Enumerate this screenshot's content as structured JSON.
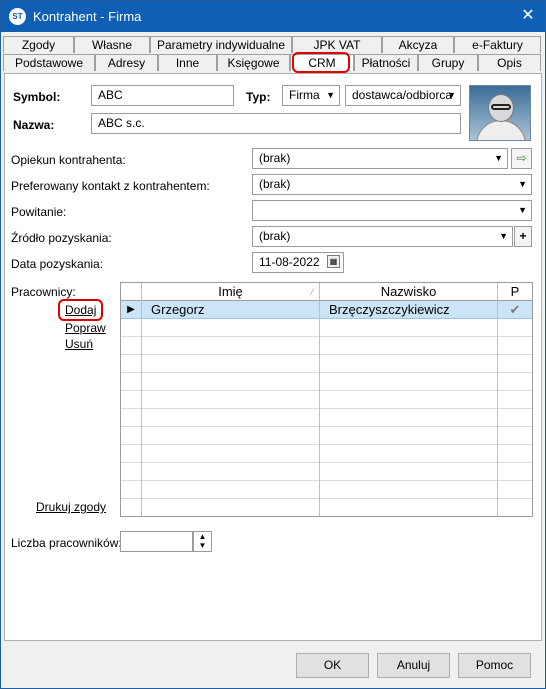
{
  "window": {
    "title": "Kontrahent - Firma",
    "icon_text": "ST"
  },
  "tabs_row1": [
    "Zgody",
    "Własne",
    "Parametry indywidualne",
    "JPK VAT",
    "Akcyza",
    "e-Faktury"
  ],
  "tabs_row2": [
    "Podstawowe",
    "Adresy",
    "Inne",
    "Księgowe",
    "CRM",
    "Płatności",
    "Grupy",
    "Opis"
  ],
  "header": {
    "symbol_label": "Symbol:",
    "symbol_value": "ABC",
    "typ_label": "Typ:",
    "typ_value": "Firma",
    "typ2_value": "dostawca/odbiorca",
    "nazwa_label": "Nazwa:",
    "nazwa_value": "ABC s.c."
  },
  "form": {
    "opiekun_label": "Opiekun kontrahenta:",
    "opiekun_value": "(brak)",
    "kontakt_label": "Preferowany kontakt z kontrahentem:",
    "kontakt_value": "(brak)",
    "powitanie_label": "Powitanie:",
    "powitanie_value": "",
    "zrodlo_label": "Źródło pozyskania:",
    "zrodlo_value": "(brak)",
    "data_label": "Data pozyskania:",
    "data_value": "11-08-2022"
  },
  "workers": {
    "label": "Pracownicy:",
    "add": "Dodaj",
    "edit": "Popraw",
    "remove": "Usuń",
    "print": "Drukuj zgody",
    "columns": [
      "Imię",
      "Nazwisko",
      "P"
    ],
    "rows": [
      {
        "imie": "Grzegorz",
        "nazwisko": "Brzęczyszczykiewicz",
        "p": "✔"
      }
    ],
    "count_label": "Liczba pracowników:",
    "count_value": ""
  },
  "buttons": {
    "ok": "OK",
    "cancel": "Anuluj",
    "help": "Pomoc"
  },
  "colors": {
    "titlebar": "#0f5fb5",
    "selected_row": "#cce4f7",
    "highlight": "#e00000"
  }
}
